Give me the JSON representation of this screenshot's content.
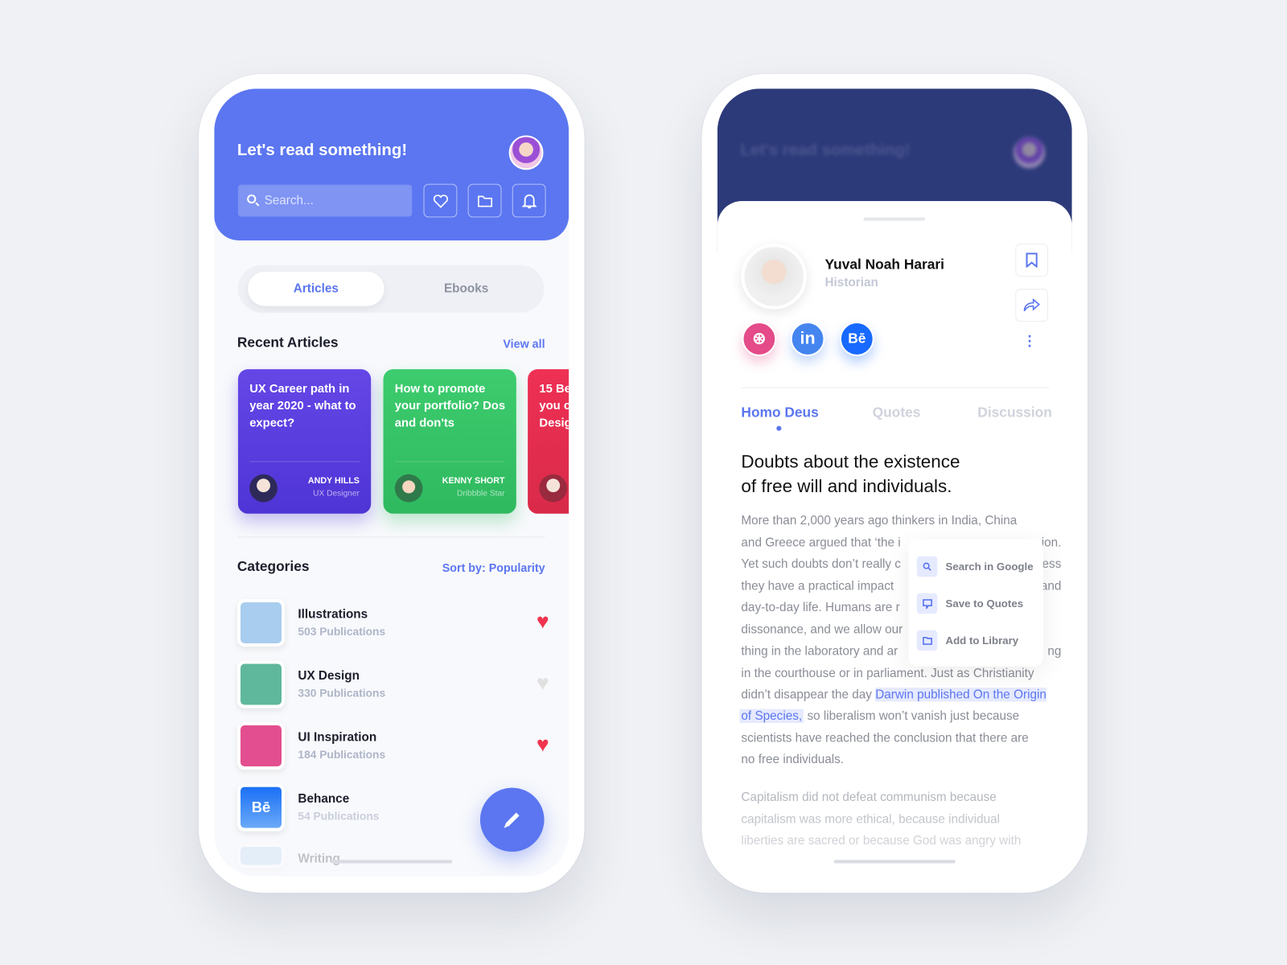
{
  "colors": {
    "accent": "#5b76f0",
    "dark_header": "#2d3a7a",
    "heart_active": "#f0344f",
    "heart_inactive": "#e0e0e0"
  },
  "left": {
    "header": {
      "title": "Let's read something!",
      "search_placeholder": "Search...",
      "icons": [
        "heart-icon",
        "folder-icon",
        "bell-icon"
      ]
    },
    "tabs": [
      "Articles",
      "Ebooks"
    ],
    "active_tab": "Articles",
    "recent": {
      "title": "Recent Articles",
      "link": "View all",
      "cards": [
        {
          "title": "UX Career path in year 2020 - what to expect?",
          "author": "ANDY HILLS",
          "role": "UX Designer",
          "color": "#5a3fe0"
        },
        {
          "title": "How to promote your portfolio? Dos and don'ts",
          "author": "KENNY SHORT",
          "role": "Dribbble Star",
          "color": "#33c46a"
        },
        {
          "title": "15 Be you c Desig",
          "author": "",
          "role": "",
          "color": "#e8304f"
        }
      ]
    },
    "categories": {
      "title": "Categories",
      "sort": "Sort by: Popularity",
      "items": [
        {
          "name": "Illustrations",
          "count": "503 Publications",
          "favorite": true
        },
        {
          "name": "UX Design",
          "count": "330 Publications",
          "favorite": false
        },
        {
          "name": "UI Inspiration",
          "count": "184 Publications",
          "favorite": true
        },
        {
          "name": "Behance",
          "count": "54 Publications",
          "favorite": false
        },
        {
          "name": "Writing",
          "count": ""
        }
      ]
    }
  },
  "right": {
    "blurred_title": "Let's read something!",
    "author": {
      "name": "Yuval Noah Harari",
      "role": "Historian"
    },
    "social": [
      "Dribbble",
      "in",
      "Bē"
    ],
    "tabs": [
      "Homo Deus",
      "Quotes",
      "Discussion"
    ],
    "active_tab": "Homo Deus",
    "heading": [
      "Doubts about the existence",
      "of free will and individuals."
    ],
    "lines": [
      {
        "l": "More than 2,000 years ago thinkers in India, China",
        "r": ""
      },
      {
        "l": "and Greece argued that ‘the i",
        "r": "ion."
      },
      {
        "l": "Yet such doubts don’t really c",
        "r": "less"
      },
      {
        "l": "they have a practical impact",
        "r": "and"
      },
      {
        "l": "day-to-day life. Humans are r",
        "r": ""
      },
      {
        "l": "dissonance, and we allow our",
        "r": ""
      },
      {
        "l": "thing in the laboratory and ar",
        "r": "ng"
      },
      {
        "l": "in the courthouse or in parliament. Just as Christianity",
        "r": ""
      }
    ],
    "line9": {
      "pre": "didn’t disappear the day ",
      "hl": "Darwin published On the Origin"
    },
    "line10": {
      "hl": "of Species,",
      "post": " so liberalism won’t vanish just because"
    },
    "line11": "scientists have reached the conclusion that there are",
    "line12": "no free individuals.",
    "para2": [
      "Capitalism did not defeat communism because",
      "capitalism was more ethical, because individual",
      "liberties are sacred or because God was angry with"
    ],
    "popup": [
      "Search in Google",
      "Save to Quotes",
      "Add to Library"
    ]
  }
}
